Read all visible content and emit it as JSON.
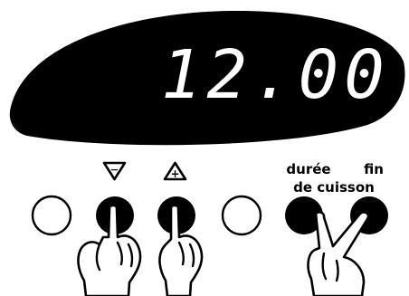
{
  "display": {
    "time": "12.00"
  },
  "buttons": {
    "minus_symbol": "−",
    "plus_symbol": "+",
    "duree_label": "durée",
    "fin_label": "fin",
    "de_cuisson_label": "de cuisson"
  },
  "icons": {
    "minus": "triangle-down-minus-icon",
    "plus": "triangle-up-plus-icon",
    "hand": "pointing-hand-icon",
    "v_hand": "two-finger-hand-icon"
  },
  "colors": {
    "display_bg": "#000000",
    "digits": "#ffffff",
    "button_dark": "#000000",
    "button_light": "#ffffff"
  }
}
